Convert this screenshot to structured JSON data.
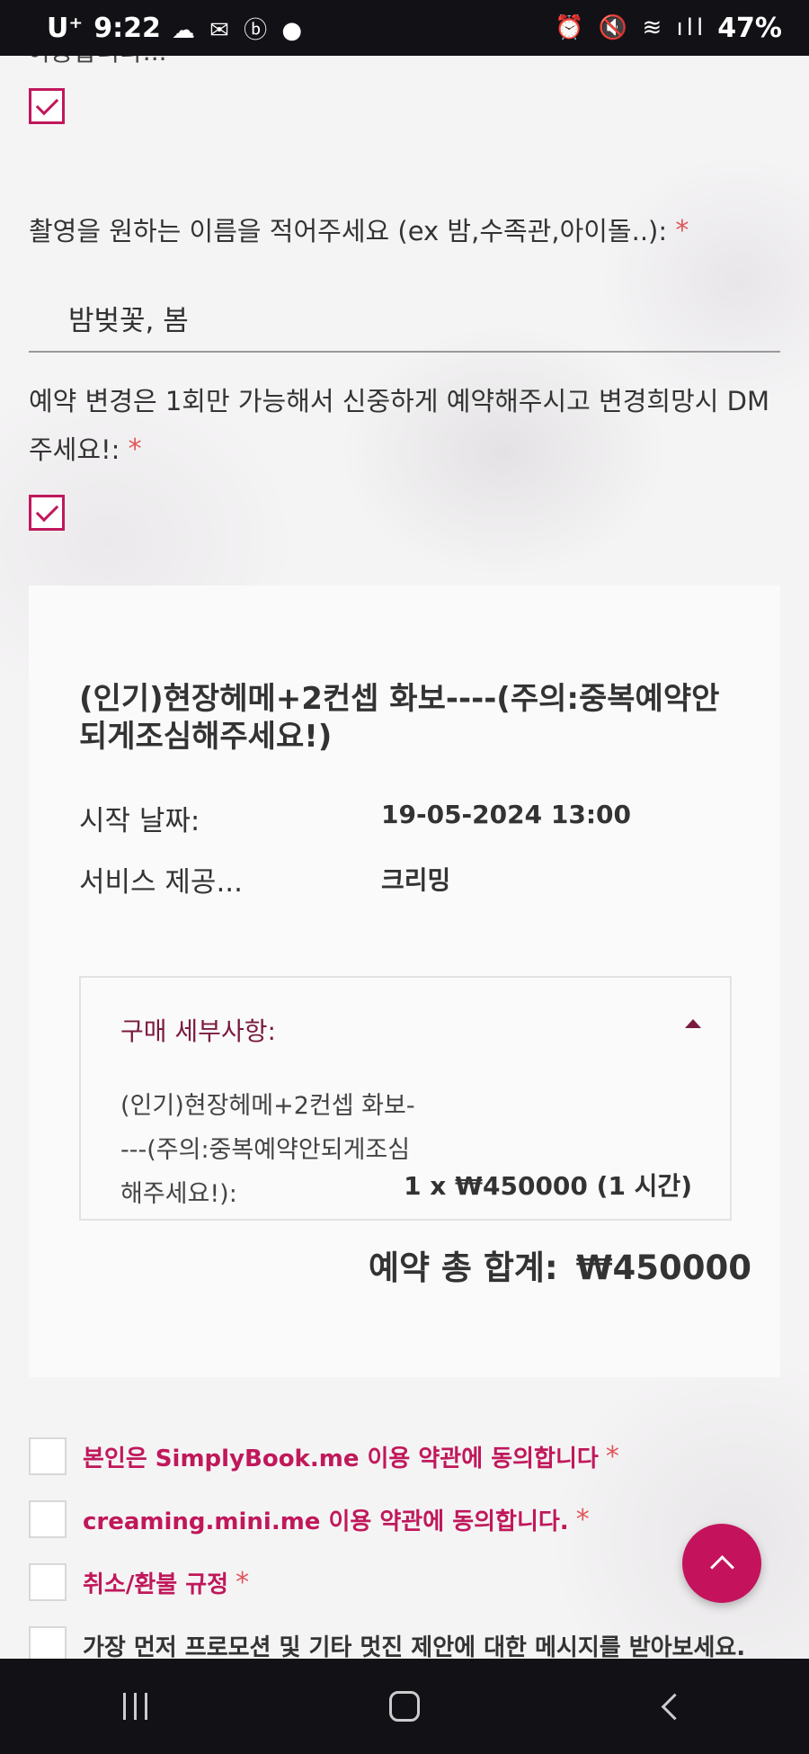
{
  "status_bar": {
    "carrier": "U⁺",
    "time": "9:22",
    "left_icons": "☁ ✉ ⓑ ●",
    "right_icons": "⏰ 🔇 ≋ ıll",
    "battery": "47%"
  },
  "form": {
    "partial_top_text": "이용합니다...",
    "name_question": "촬영을 원하는 이름을 적어주세요 (ex 밤,수족관,아이돌..):",
    "name_value": "밤벚꽃, 봄",
    "change_question": "예약 변경은 1회만 가능해서 신중하게 예약해주시고 변경희망시 DM 주세요!:",
    "required_mark": "*"
  },
  "booking": {
    "title": "(인기)현장헤메+2컨셉 화보----(주의:중복예약안되게조심해주세요!)",
    "start_label": "시작 날짜:",
    "start_value": "19-05-2024 13:00",
    "provider_label": "서비스 제공...",
    "provider_value": "크리밍",
    "details_title": "구매 세부사항:",
    "item_desc": "(인기)현장헤메+2컨셉 화보----(주의:중복예약안되게조심해주세요!):",
    "item_qty": "1 x ₩450000 (1 시간)",
    "total_label": "예약 총 합계:",
    "total_value": "₩450000"
  },
  "agreements": [
    {
      "label": "본인은 SimplyBook.me 이용 약관에 동의합니다",
      "required": "*"
    },
    {
      "label": "creaming.mini.me 이용 약관에 동의합니다.",
      "required": "*"
    },
    {
      "label": "취소/환불 규정",
      "required": "*"
    },
    {
      "label": "가장 먼저 프로모션 및 기타 멋진 제안에 대한 메시지를 받아보세요.",
      "required": ""
    }
  ],
  "colors": {
    "accent": "#c0185b",
    "required": "#e0565b",
    "details_title": "#7a1a3e"
  },
  "icons": [
    "chevron-up-icon",
    "recent-apps-icon",
    "home-icon",
    "back-icon"
  ]
}
